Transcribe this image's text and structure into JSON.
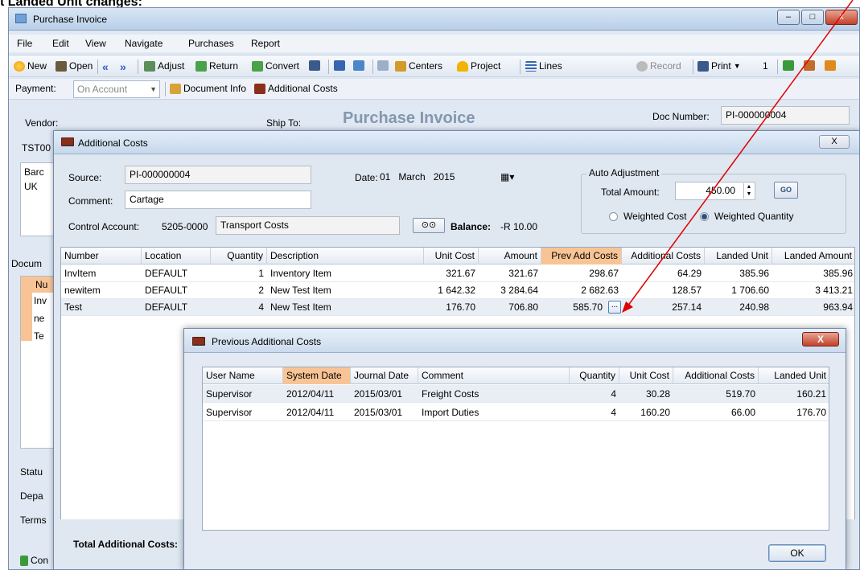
{
  "caption": "t Landed Unit changes:",
  "main": {
    "title": "Purchase Invoice",
    "window_controls": [
      "–",
      "□",
      "x"
    ],
    "menu": [
      "File",
      "Edit",
      "View",
      "Navigate",
      "Purchases",
      "Report"
    ],
    "toolbar": [
      "New",
      "Open",
      "Adjust",
      "Return",
      "Convert",
      "Centers",
      "Project",
      "Lines",
      "Record",
      "Print",
      "1"
    ],
    "payment_label": "Payment:",
    "payment_value": "On Account",
    "document_info": "Document Info",
    "additional_costs": "Additional Costs",
    "vendor_label": "Vendor:",
    "ship_to_label": "Ship To:",
    "form_title": "Purchase Invoice",
    "doc_number_label": "Doc Number:",
    "doc_number": "PI-000000004",
    "vendor_code_frag": "TST00",
    "address_frag_1": "Barc",
    "address_frag_2": "UK",
    "doc_tab_frag": "Docum",
    "left_frags": [
      "Nu",
      "Inv",
      "ne",
      "Te"
    ],
    "bottom_frags": [
      "Statu",
      "Depa",
      "Terms",
      "Con"
    ]
  },
  "dialog": {
    "title": "Additional Costs",
    "close": "X",
    "source_label": "Source:",
    "source": "PI-000000004",
    "date_label": "Date:",
    "date_day": "01",
    "date_month": "March",
    "date_year": "2015",
    "comment_label": "Comment:",
    "comment": "Cartage",
    "control_account_label": "Control Account:",
    "control_account_code": "5205-0000",
    "control_account_name": "Transport Costs",
    "balance_label": "Balance:",
    "balance": "-R 10.00",
    "auto_adjustment": "Auto Adjustment",
    "total_amount_label": "Total Amount:",
    "total_amount": "450.00",
    "go_label": "GO",
    "weighted_cost": "Weighted Cost",
    "weighted_quantity": "Weighted Quantity",
    "total_additional_label": "Total Additional Costs:",
    "columns": [
      "Number",
      "Location",
      "Quantity",
      "Description",
      "Unit Cost",
      "Amount",
      "Prev Add Costs",
      "Additional Costs",
      "Landed Unit",
      "Landed Amount"
    ],
    "rows": [
      [
        "InvItem",
        "DEFAULT",
        "1",
        "Inventory Item",
        "321.67",
        "321.67",
        "298.67",
        "64.29",
        "385.96",
        "385.96"
      ],
      [
        "newitem",
        "DEFAULT",
        "2",
        "New Test Item",
        "1 642.32",
        "3 284.64",
        "2 682.63",
        "128.57",
        "1 706.60",
        "3 413.21"
      ],
      [
        "Test",
        "DEFAULT",
        "4",
        "New Test Item",
        "176.70",
        "706.80",
        "585.70",
        "257.14",
        "240.98",
        "963.94"
      ]
    ],
    "ellipsis": "..."
  },
  "prev_dialog": {
    "title": "Previous Additional Costs",
    "close": "X",
    "columns": [
      "User Name",
      "System Date",
      "Journal Date",
      "Comment",
      "Quantity",
      "Unit Cost",
      "Additional Costs",
      "Landed Unit"
    ],
    "rows": [
      [
        "Supervisor",
        "2012/04/11",
        "2015/03/01",
        "Freight Costs",
        "4",
        "30.28",
        "519.70",
        "160.21"
      ],
      [
        "Supervisor",
        "2012/04/11",
        "2015/03/01",
        "Import Duties",
        "4",
        "160.20",
        "66.00",
        "176.70"
      ]
    ],
    "ok": "OK"
  },
  "colors": {
    "highlight_header": "#f8c495",
    "arrow": "#e00000"
  }
}
